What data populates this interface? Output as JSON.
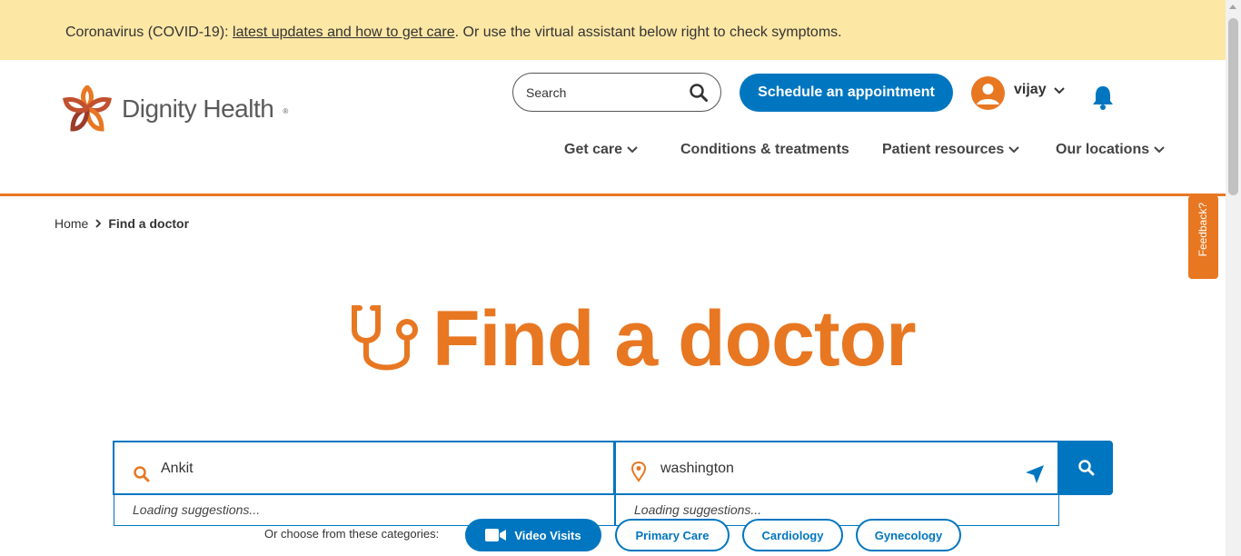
{
  "banner": {
    "prefix": "Coronavirus (COVID-19): ",
    "link": "latest updates and how to get care",
    "suffix": ". Or use the virtual assistant below right to check symptoms."
  },
  "header": {
    "logo_text": "Dignity Health",
    "search_placeholder": "Search",
    "schedule_label": "Schedule an appointment",
    "user_name": "vijay",
    "nav": [
      "Get care",
      "Conditions & treatments",
      "Patient resources",
      "Our locations"
    ]
  },
  "breadcrumb": {
    "home": "Home",
    "current": "Find a doctor"
  },
  "feedback_label": "Feedback?",
  "hero": {
    "title": "Find a doctor"
  },
  "finder": {
    "name_value": "Ankit",
    "location_value": "washington",
    "name_suggestion": "Loading suggestions...",
    "location_suggestion": "Loading suggestions..."
  },
  "categories": {
    "label": "Or choose from these categories:",
    "items": [
      "Video Visits",
      "Primary Care",
      "Cardiology",
      "Gynecology"
    ]
  },
  "colors": {
    "accent": "#e87722",
    "primary": "#0076c0",
    "banner": "#fde7a5"
  }
}
